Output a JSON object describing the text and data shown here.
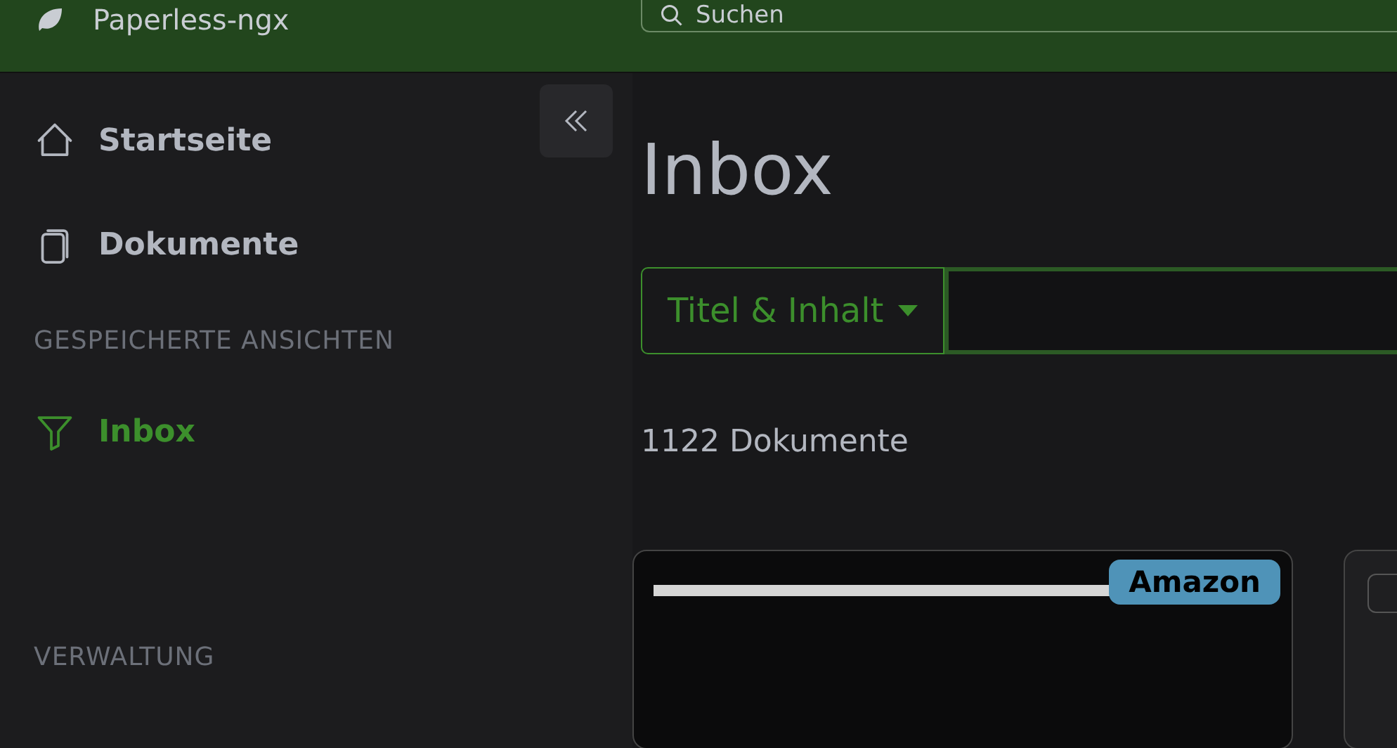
{
  "header": {
    "app_title": "Paperless-ngx",
    "search": {
      "placeholder": "Suchen"
    }
  },
  "sidebar": {
    "items": [
      {
        "label": "Startseite",
        "kind": "home",
        "selected": false
      },
      {
        "label": "Dokumente",
        "kind": "documents",
        "selected": false
      }
    ],
    "sections": [
      {
        "title": "GESPEICHERTE ANSICHTEN",
        "items": [
          {
            "label": "Inbox",
            "kind": "filter",
            "selected": true
          }
        ]
      },
      {
        "title": "VERWALTUNG"
      }
    ]
  },
  "main": {
    "title": "Inbox",
    "filter": {
      "mode": "Titel & Inhalt"
    },
    "count": "1122 Dokumente",
    "cards": [
      {
        "kind": "document",
        "tags": [
          {
            "label": "Amazon",
            "color": "#4f93b8"
          }
        ]
      },
      {
        "kind": "partial",
        "checked": false
      }
    ]
  }
}
